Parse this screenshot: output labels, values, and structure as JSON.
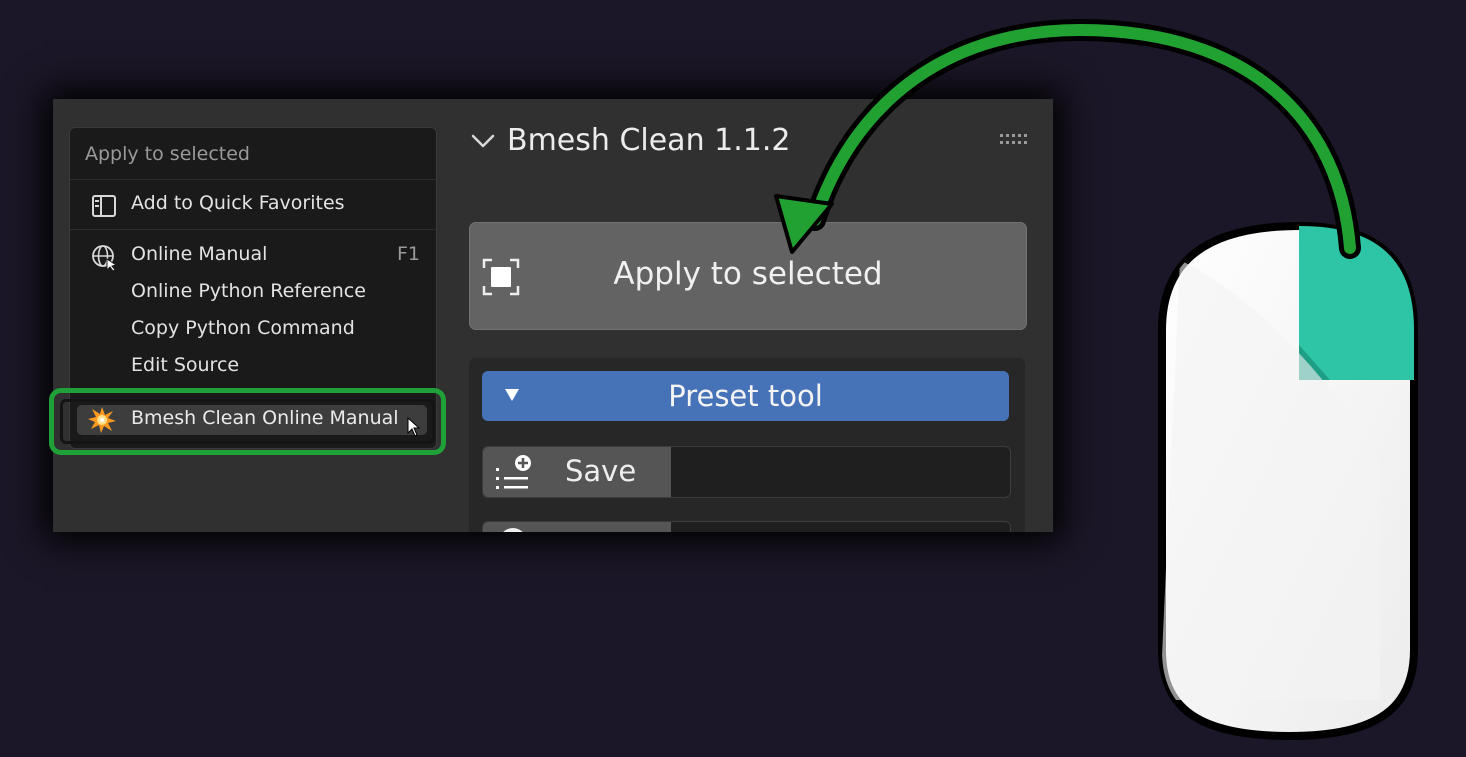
{
  "context_menu": {
    "title": "Apply to selected",
    "items": [
      {
        "label": "Add to Quick Favorites",
        "icon": "quick-favorites-icon",
        "shortcut": ""
      },
      {
        "label": "Online Manual",
        "icon": "globe-icon",
        "shortcut": "F1"
      },
      {
        "label": "Online Python Reference",
        "icon": "",
        "shortcut": ""
      },
      {
        "label": "Copy Python Command",
        "icon": "",
        "shortcut": ""
      },
      {
        "label": "Edit Source",
        "icon": "",
        "shortcut": ""
      }
    ],
    "highlighted_item": {
      "label": "Bmesh Clean Online Manual",
      "icon": "bmesh-clean-addon-icon"
    }
  },
  "panel": {
    "title": "Bmesh Clean 1.1.2",
    "apply_button": "Apply to selected",
    "preset_button": "Preset tool",
    "save_label": "Save"
  },
  "colors": {
    "background": "#1c1728",
    "highlight_green": "#1fa038",
    "preset_blue": "#4672b8",
    "mouse_accent": "#2ec4a6"
  }
}
